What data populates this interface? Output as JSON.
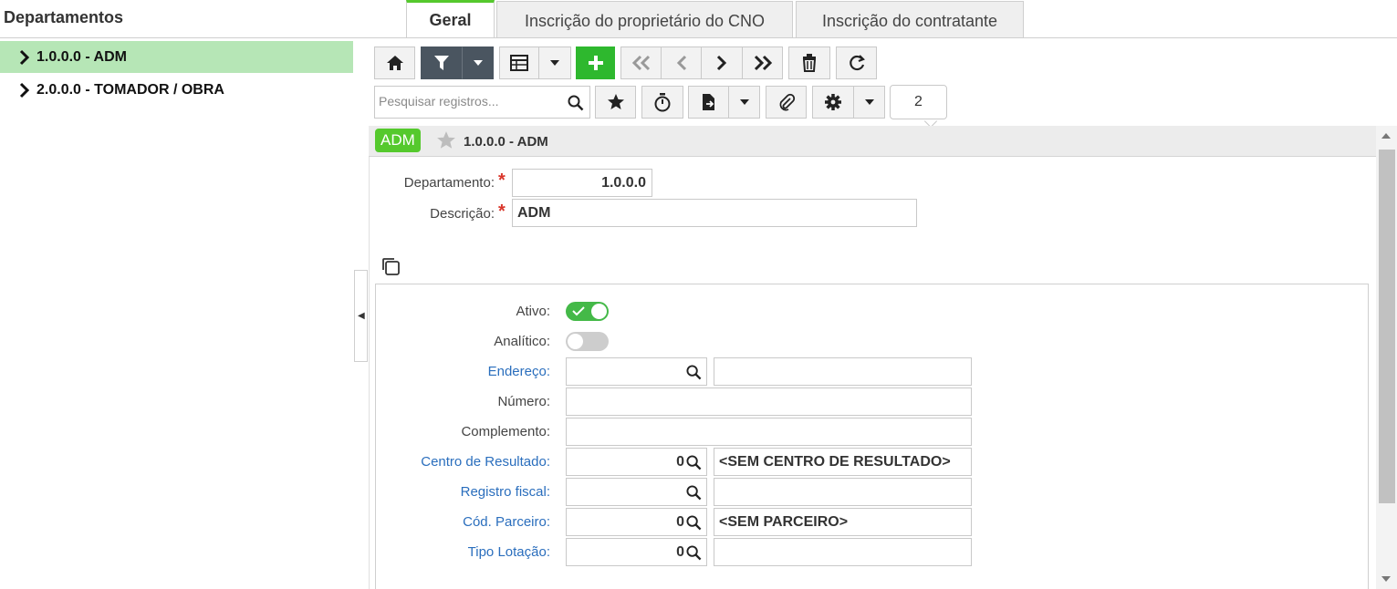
{
  "page": {
    "title": "Departamentos"
  },
  "tree": {
    "items": [
      {
        "label": "1.0.0.0 - ADM",
        "selected": true
      },
      {
        "label": "2.0.0.0 - TOMADOR / OBRA",
        "selected": false
      }
    ]
  },
  "toolbar": {
    "search_placeholder": "Pesquisar registros...",
    "record_count": "2",
    "icons": [
      "home-icon",
      "filter-icon",
      "caret-down-icon",
      "grid-icon",
      "caret-down-icon",
      "plus-icon",
      "first-icon",
      "prev-icon",
      "next-icon",
      "last-icon",
      "trash-icon",
      "refresh-icon",
      "search-icon",
      "star-icon",
      "timer-icon",
      "export-icon",
      "caret-down-icon",
      "paperclip-icon",
      "gear-icon",
      "caret-down-icon"
    ]
  },
  "record": {
    "badge": "ADM",
    "title": "1.0.0.0 - ADM"
  },
  "form": {
    "departamento_label": "Departamento:",
    "departamento_value": "1.0.0.0",
    "descricao_label": "Descrição:",
    "descricao_value": "ADM"
  },
  "tabs": [
    {
      "label": "Geral",
      "active": true
    },
    {
      "label": "Inscrição do proprietário do CNO",
      "active": false
    },
    {
      "label": "Inscrição do contratante",
      "active": false
    }
  ],
  "geral": {
    "ativo_label": "Ativo:",
    "ativo_value": true,
    "analitico_label": "Analítico:",
    "analitico_value": false,
    "endereco_label": "Endereço:",
    "endereco_code": "",
    "endereco_desc": "",
    "numero_label": "Número:",
    "numero_value": "",
    "complemento_label": "Complemento:",
    "complemento_value": "",
    "centro_label": "Centro de Resultado:",
    "centro_code": "0",
    "centro_desc": "<SEM CENTRO DE RESULTADO>",
    "registro_label": "Registro fiscal:",
    "registro_code": "",
    "registro_desc": "",
    "parceiro_label": "Cód. Parceiro:",
    "parceiro_code": "0",
    "parceiro_desc": "<SEM PARCEIRO>",
    "lotacao_label": "Tipo Lotação:",
    "lotacao_code": "0",
    "lotacao_desc": ""
  },
  "colors": {
    "accent_green": "#55c92d",
    "selected_row": "#b6e6b6",
    "link": "#2a6ebd",
    "dark_button": "#4a5560"
  }
}
